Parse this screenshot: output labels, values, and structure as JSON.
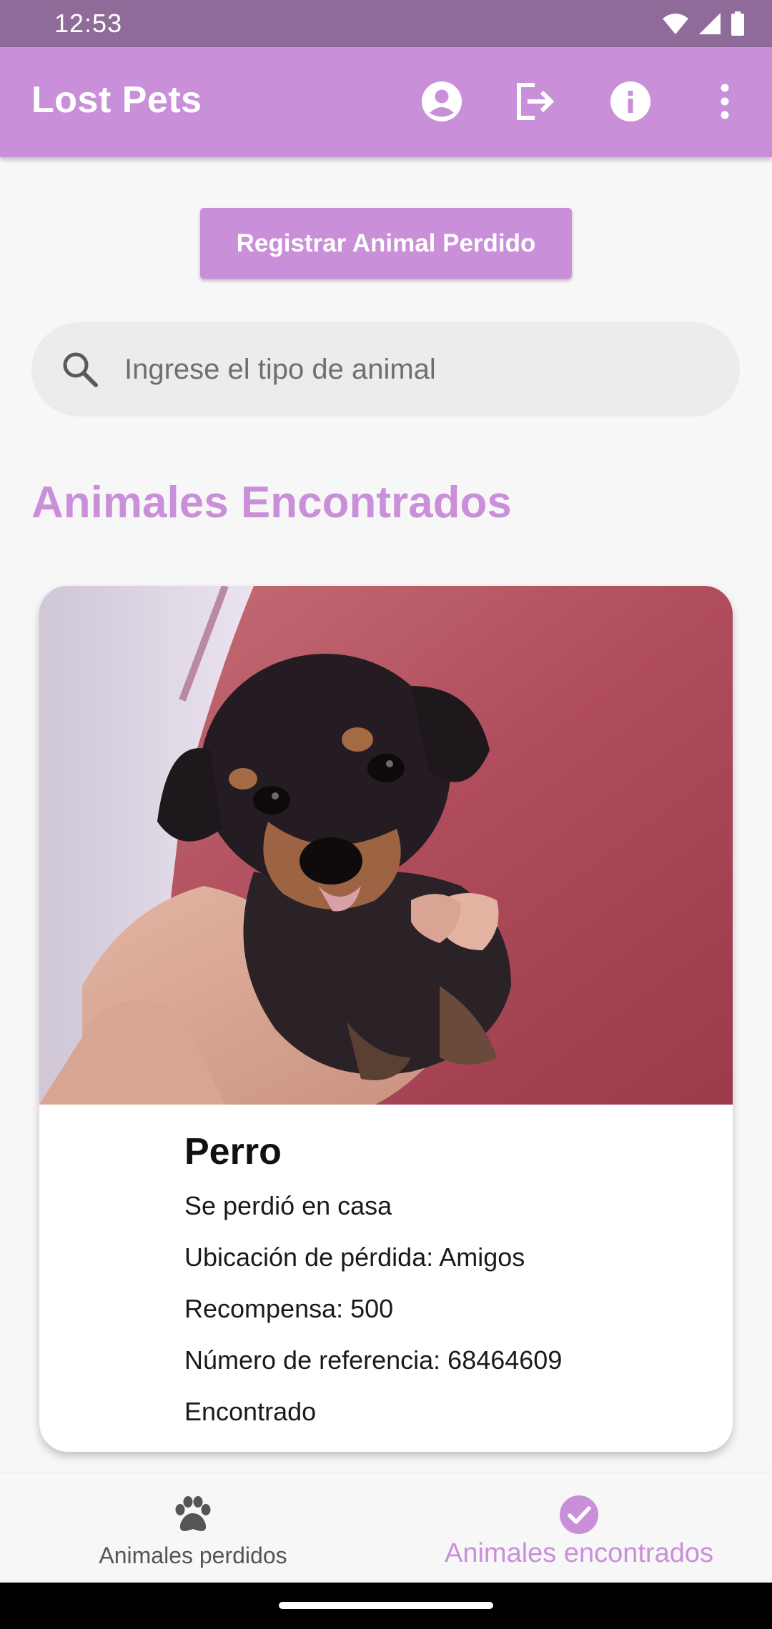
{
  "status_bar": {
    "time": "12:53"
  },
  "app_bar": {
    "title": "Lost Pets",
    "icons": [
      "account-circle-icon",
      "logout-icon",
      "info-icon",
      "more-vert-icon"
    ]
  },
  "register_button": {
    "label": "Registrar Animal Perdido"
  },
  "search": {
    "placeholder": "Ingrese el tipo de animal",
    "value": ""
  },
  "section_title": "Animales Encontrados",
  "card": {
    "photo": "puppy-photo",
    "title": "Perro",
    "description": "Se perdió en casa",
    "location": "Ubicación de pérdida: Amigos",
    "reward": "Recompensa: 500",
    "reference": "Número de referencia: 68464609",
    "status": "Encontrado"
  },
  "bottom_nav": {
    "items": [
      {
        "label": "Animales perdidos",
        "icon": "paw-icon",
        "active": false
      },
      {
        "label": "Animales encontrados",
        "icon": "check-circle-icon",
        "active": true
      }
    ]
  },
  "colors": {
    "primary": "#ca8fd9",
    "status_bar": "#8f6b99",
    "background": "#f8f7f8",
    "search_bg": "#ececec"
  }
}
